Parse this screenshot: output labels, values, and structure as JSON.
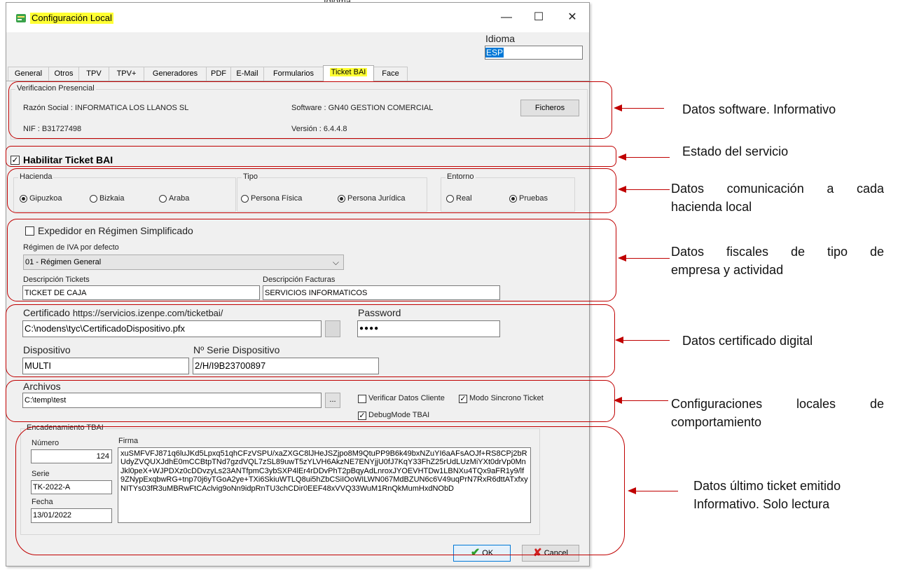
{
  "window": {
    "title": "Configuración Local",
    "minimize": "—",
    "maximize": "☐",
    "close": "✕"
  },
  "idioma": {
    "label": "Idioma",
    "value": "ESP"
  },
  "bg_fragment": "Idioma",
  "tabs": [
    "General",
    "Otros",
    "TPV",
    "TPV+",
    "Generadores",
    "PDF",
    "E-Mail",
    "Formularios",
    "Ticket BAI",
    "Face"
  ],
  "active_tab": "Ticket BAI",
  "verificacion": {
    "group_title": "Verificacion Presencial",
    "razon_social": "Razón Social : INFORMATICA LOS LLANOS SL",
    "nif": "NIF : B31727498",
    "software": "Software : GN40 GESTION COMERCIAL",
    "version": "Versión : 6.4.4.8",
    "ficheros_button": "Ficheros"
  },
  "habilitar": {
    "label": "Habilitar Ticket BAI",
    "checked": true
  },
  "hacienda": {
    "title": "Hacienda",
    "options": [
      "Gipuzkoa",
      "Bizkaia",
      "Araba"
    ],
    "selected": "Gipuzkoa"
  },
  "tipo": {
    "title": "Tipo",
    "options": [
      "Persona Física",
      "Persona Jurídica"
    ],
    "selected": "Persona Jurídica"
  },
  "entorno": {
    "title": "Entorno",
    "options": [
      "Real",
      "Pruebas"
    ],
    "selected": "Pruebas"
  },
  "fiscal": {
    "expedidor_label": "Expedidor en Régimen Simplificado",
    "expedidor_checked": false,
    "regimen_label": "Régimen de IVA por defecto",
    "regimen_value": "01 - Régimen General",
    "desc_tickets_label": "Descripción Tickets",
    "desc_tickets_value": "TICKET DE CAJA",
    "desc_facturas_label": "Descripción Facturas",
    "desc_facturas_value": "SERVICIOS INFORMATICOS"
  },
  "certificado": {
    "label": "Certificado",
    "url": "https://servicios.izenpe.com/ticketbai/",
    "path": "C:\\nodens\\tyc\\CertificadoDispositivo.pfx",
    "password_label": "Password",
    "password_value": "●●●●",
    "dispositivo_label": "Dispositivo",
    "dispositivo_value": "MULTI",
    "serie_label": "Nº Serie Dispositivo",
    "serie_value": "2/H/I9B23700897"
  },
  "archivos": {
    "label": "Archivos",
    "path": "C:\\temp\\test",
    "browse": "...",
    "verificar_label": "Verificar Datos Cliente",
    "verificar_checked": false,
    "sincrono_label": "Modo Sincrono Ticket",
    "sincrono_checked": true,
    "debug_label": "DebugMode TBAI",
    "debug_checked": true
  },
  "encadenamiento": {
    "title": "Encadenamiento TBAI",
    "numero_label": "Número",
    "numero_value": "124",
    "serie_label": "Serie",
    "serie_value": "TK-2022-A",
    "fecha_label": "Fecha",
    "fecha_value": "13/01/2022",
    "firma_label": "Firma",
    "firma_value": "xuSMFVFJ871q6luJKd5Lpxq51qhCFzVSPU/xaZXGC8lJHeJSZjpo8M9QtuPP9B6k49bxNZuYI6aAFsAOJf+RS8CPj2bRUdyZVQUXJdhE0mCCBtpTNd7gzdVQL7zSL89uwT5zYLVH6AkzNE7ENYjjU0fJ7KqY33FhZ25rUdLUzMiYXt0drVp0MnJkl0peX+WJPDXz0cDDvzyLs23ANTfpmC3ybSXP4lEr4rDDvPhT2pBqyAdLnroxJYOEVHTDw1LBNXu4TQx9aFR1y9/lf9ZNypExqbwRG+tnp70j6yTGoA2ye+TXi6SkiuWTLQ8ui5hZbCSiIOoWILWN067MdBZUN6c6V49uqPrN7RxR6dttATxfxyNITYs03fR3uMBRwFtCAclvig9oNn9idpRnTU3chCDir0EEF48xVVQ33WuM1RnQkMumHxdNObD"
  },
  "buttons": {
    "ok": "OK",
    "cancel": "Cancel"
  },
  "annotations": [
    "Datos software. Informativo",
    "Estado del servicio",
    "Datos comunicación a cada hacienda local",
    "Datos fiscales de tipo de empresa y actividad",
    "Datos certificado digital",
    "Configuraciones locales de comportamiento",
    "Datos último ticket emitido Informativo. Solo lectura"
  ],
  "annotation_lines": {
    "hacienda": [
      "Datos comunicación a cada",
      "hacienda local"
    ],
    "fiscal": [
      "Datos fiscales de tipo de",
      "empresa y actividad"
    ],
    "config": [
      "Configuraciones locales de",
      "comportamiento"
    ],
    "ultimo": [
      "Datos último ticket emitido",
      "Informativo. Solo lectura"
    ]
  },
  "colors": {
    "annotation": "#c00000",
    "highlight": "#ffff33",
    "selection": "#0078d7"
  }
}
